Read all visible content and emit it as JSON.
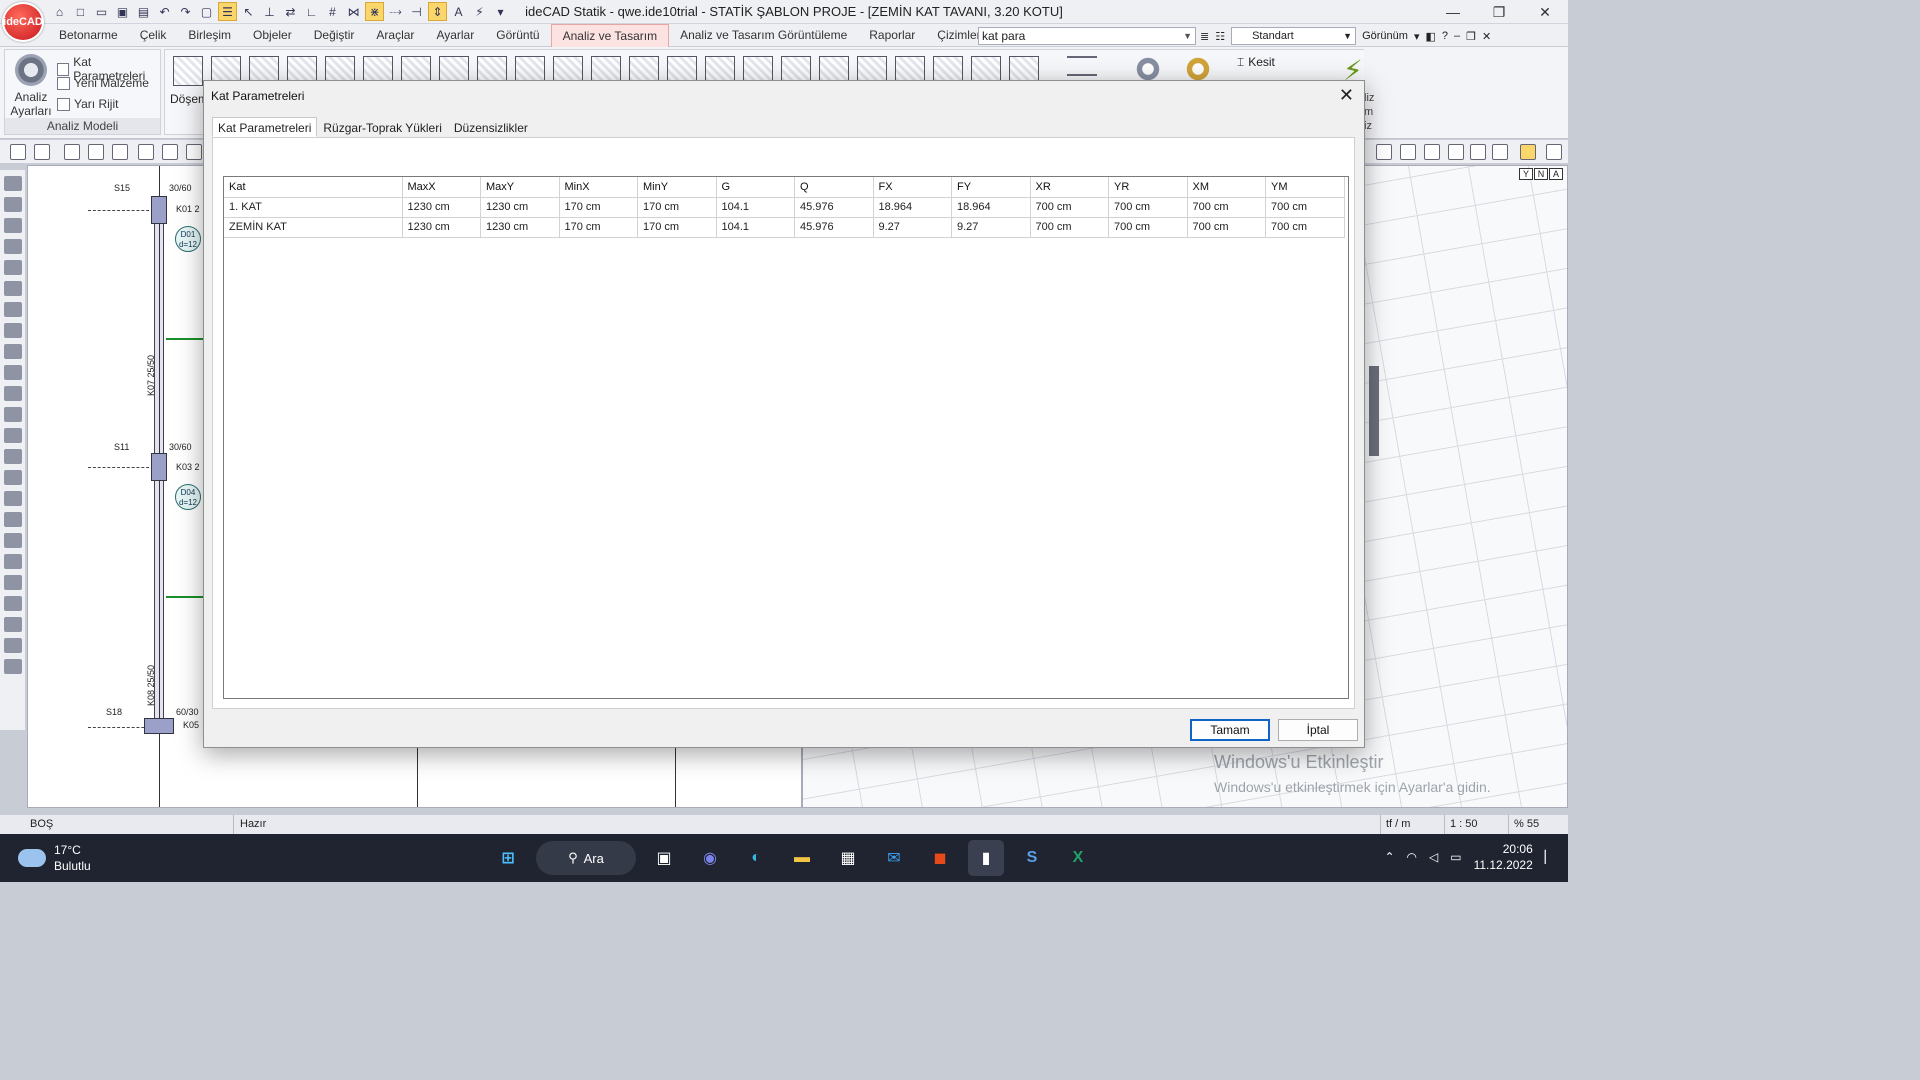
{
  "app": {
    "logo": "ideCAD",
    "title": "ideCAD Statik - qwe.ide10trial - STATİK ŞABLON PROJE - [ZEMİN KAT TAVANI,  3.20 KOTU]"
  },
  "menus": [
    "Betonarme",
    "Çelik",
    "Birleşim",
    "Objeler",
    "Değiştir",
    "Araçlar",
    "Ayarlar",
    "Görüntü",
    "Analiz ve Tasarım",
    "Analiz ve Tasarım Görüntüleme",
    "Raporlar",
    "Çizimler"
  ],
  "active_menu": "Analiz ve Tasarım",
  "command_search": {
    "value": "kat para"
  },
  "style_combo": {
    "value": "Standart"
  },
  "view_label": "Görünüm",
  "ribbon": {
    "group_analiz_modeli": {
      "label": "Analiz Modeli",
      "big_button": "Analiz Ayarları",
      "items": [
        "Kat Parametreleri",
        "Yeni Malzeme",
        "Yarı Rijit"
      ]
    },
    "dosem_label": "Döşem",
    "kesit_label": "Kesit",
    "right_partial": [
      "liz",
      "m",
      "iz"
    ]
  },
  "view_ctrls": [
    "Y",
    "N",
    "A"
  ],
  "plan": {
    "labels": [
      "S15",
      "30/60",
      "K01 2",
      "D01",
      "d=12",
      "K07 25/50",
      "S11",
      "30/60",
      "K03 2",
      "D04",
      "d=12",
      "K08 25/50",
      "S18",
      "60/30",
      "K05"
    ]
  },
  "watermark": {
    "line1": "Windows'u Etkinleştir",
    "line2": "Windows'u etkinleştirmek için Ayarlar'a gidin."
  },
  "status": {
    "left": "BOŞ",
    "center": "Hazır",
    "units": "tf / m",
    "scale": "1 : 50",
    "zoom": "% 55"
  },
  "taskbar": {
    "weather_temp": "17°C",
    "weather_desc": "Bulutlu",
    "search_label": "Ara",
    "time": "20:06",
    "date": "11.12.2022"
  },
  "dialog": {
    "title": "Kat Parametreleri",
    "tabs": [
      "Kat Parametreleri",
      "Rüzgar-Toprak Yükleri",
      "Düzensizlikler"
    ],
    "active_tab": 0,
    "columns": [
      "Kat",
      "MaxX",
      "MaxY",
      "MinX",
      "MinY",
      "G",
      "Q",
      "FX",
      "FY",
      "XR",
      "YR",
      "XM",
      "YM"
    ],
    "rows": [
      [
        "1. KAT",
        "1230 cm",
        "1230 cm",
        "170 cm",
        "170 cm",
        "104.1",
        "45.976",
        "18.964",
        "18.964",
        "700 cm",
        "700 cm",
        "700 cm",
        "700 cm"
      ],
      [
        "ZEMİN KAT",
        "1230 cm",
        "1230 cm",
        "170 cm",
        "170 cm",
        "104.1",
        "45.976",
        "9.27",
        "9.27",
        "700 cm",
        "700 cm",
        "700 cm",
        "700 cm"
      ]
    ],
    "ok_label": "Tamam",
    "cancel_label": "İptal"
  },
  "icons": {
    "close": "close-icon",
    "gear": "gear-icon",
    "search": "search-icon",
    "cloud": "cloud-icon"
  }
}
